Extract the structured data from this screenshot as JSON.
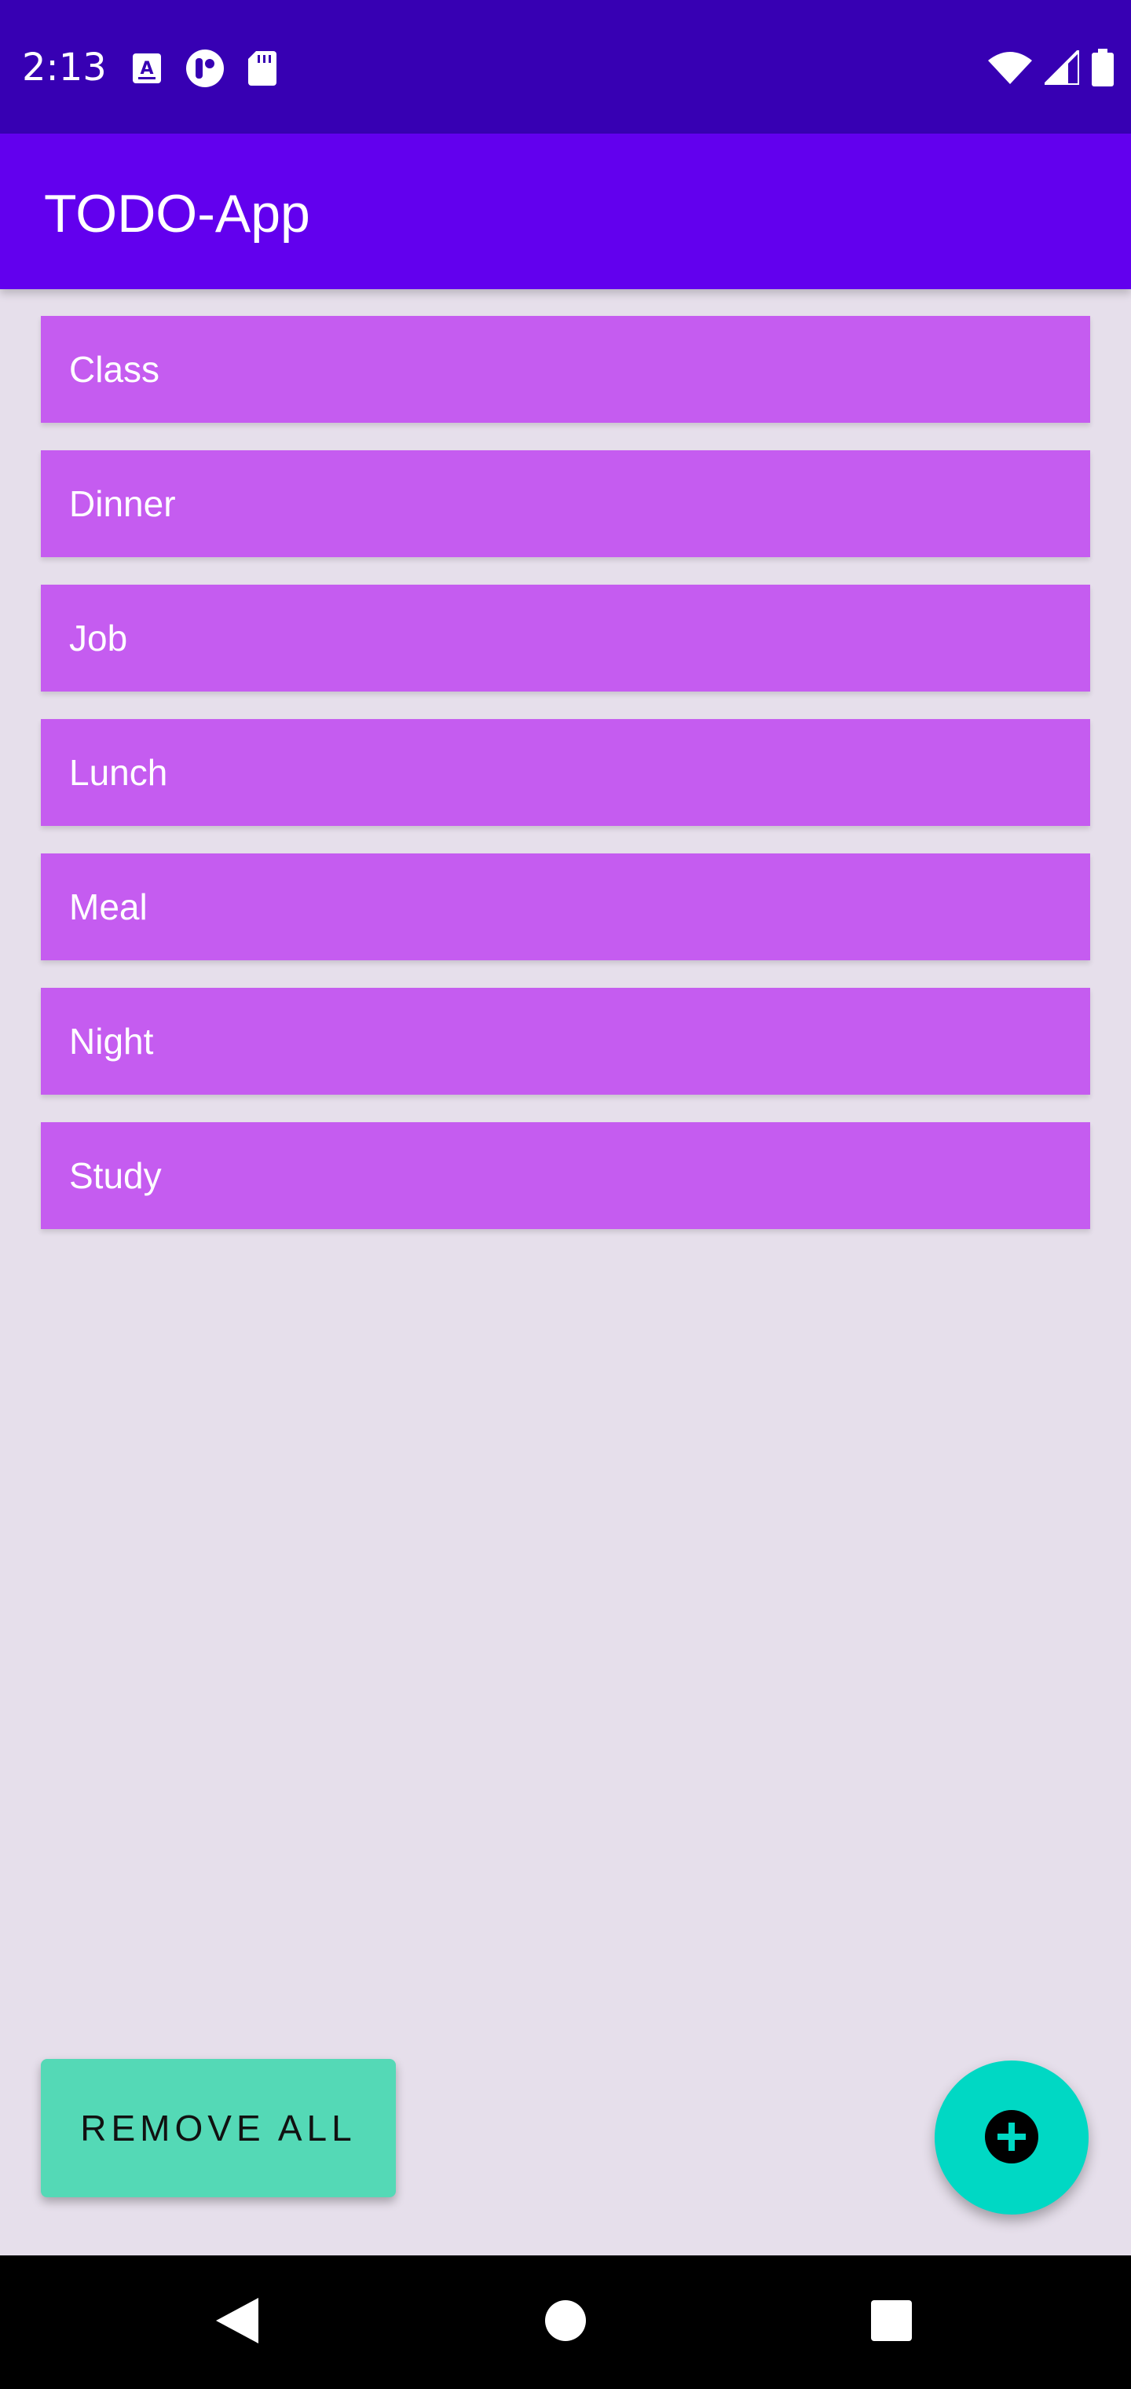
{
  "status_bar": {
    "time": "2:13",
    "left_icons": [
      "keyboard-a-icon",
      "notification-circle-icon",
      "sd-card-icon"
    ],
    "right_icons": [
      "wifi-icon",
      "cell-signal-icon",
      "battery-icon"
    ]
  },
  "app_bar": {
    "title": "TODO-App"
  },
  "todos": [
    {
      "label": "Class"
    },
    {
      "label": "Dinner"
    },
    {
      "label": "Job"
    },
    {
      "label": "Lunch"
    },
    {
      "label": "Meal"
    },
    {
      "label": "Night"
    },
    {
      "label": "Study"
    }
  ],
  "actions": {
    "remove_all_label": "REMOVE ALL",
    "add_icon": "add-circle-icon"
  },
  "nav_bar": {
    "buttons": [
      "back-icon",
      "home-icon",
      "recents-icon"
    ]
  },
  "colors": {
    "status_bar": "#3700b3",
    "app_bar": "#6200ee",
    "todo_item": "#c55cf0",
    "remove_all": "#54d9b6",
    "fab": "#00d8c4",
    "background": "#e6dfeb"
  }
}
